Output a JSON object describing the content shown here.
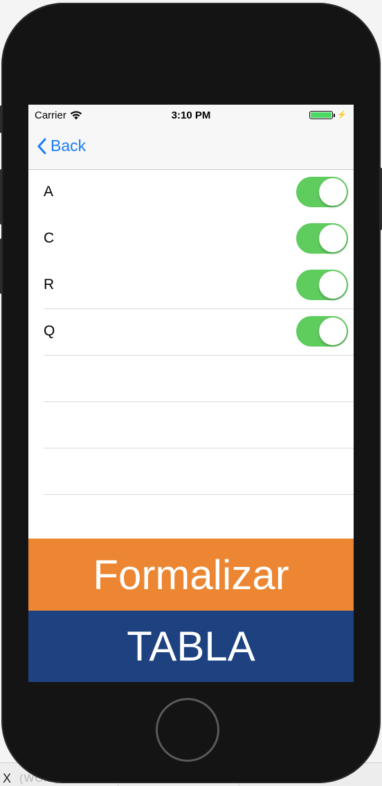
{
  "host": {
    "x_label": "X",
    "faded_text": "(WC...)"
  },
  "status_bar": {
    "carrier": "Carrier",
    "time": "3:10 PM",
    "battery_bolt": "⚡"
  },
  "nav": {
    "back_label": "Back"
  },
  "rows": [
    {
      "label": "A",
      "on": true
    },
    {
      "label": "C",
      "on": true
    },
    {
      "label": "R",
      "on": true
    },
    {
      "label": "Q",
      "on": true
    }
  ],
  "buttons": {
    "formalizar": "Formalizar",
    "tabla": "TABLA"
  },
  "colors": {
    "accent": "#1a7cf7",
    "switch_on": "#5fcc5e",
    "formalizar_bg": "#ec8632",
    "tabla_bg": "#1d427f"
  },
  "icons": {
    "back": "chevron-left-icon",
    "wifi": "wifi-icon",
    "battery": "battery-icon"
  }
}
